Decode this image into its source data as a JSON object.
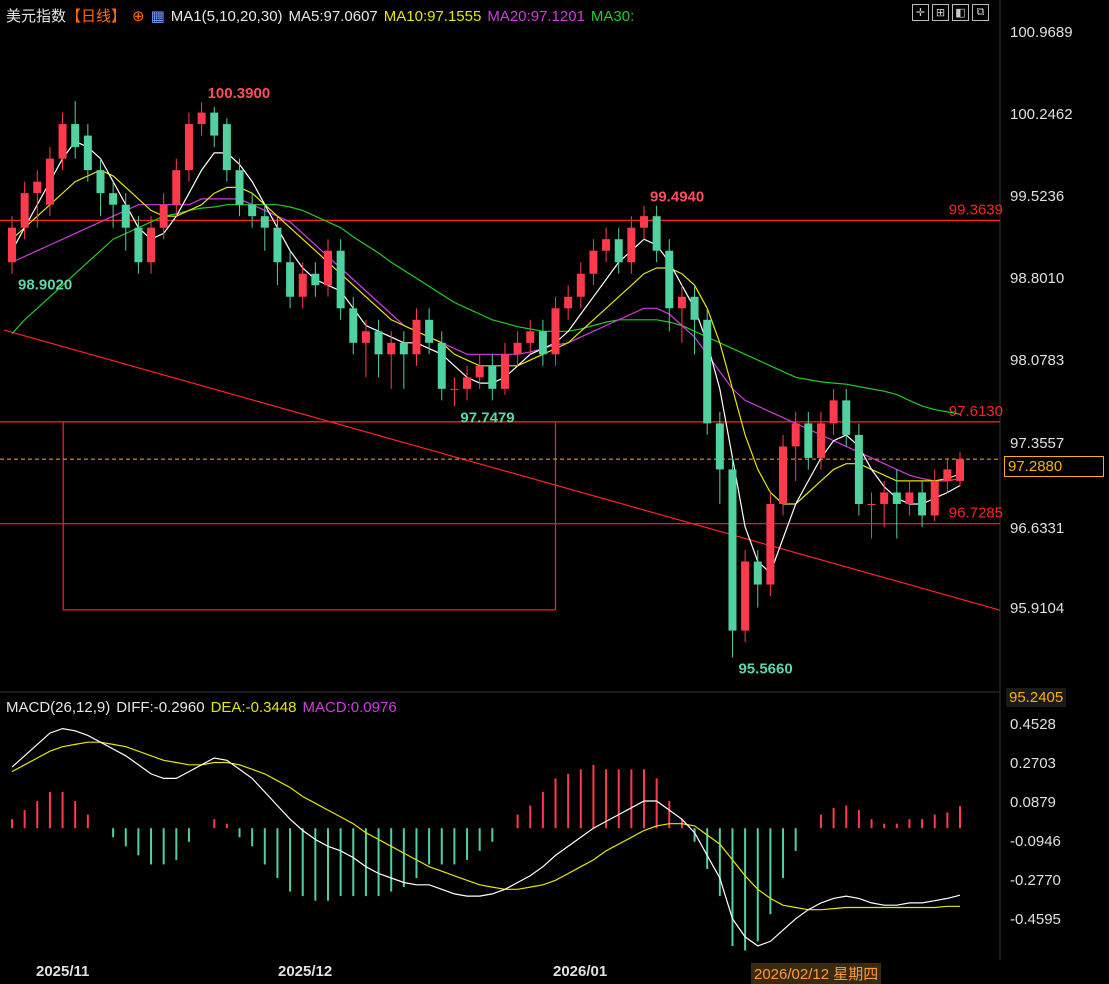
{
  "header": {
    "name": "美元指数",
    "period": "【日线】",
    "ma_label": "MA1(5,10,20,30)",
    "ma5": "MA5:97.0607",
    "ma10": "MA10:97.1555",
    "ma20": "MA20:97.1201",
    "ma30": "MA30:"
  },
  "macd_header": {
    "title": "MACD(26,12,9)",
    "diff": "DIFF:-0.2960",
    "dea": "DEA:-0.3448",
    "macd": "MACD:0.0976"
  },
  "colors": {
    "up": "#ff3a4d",
    "down": "#4fd1a0",
    "ma5": "#ffffff",
    "ma10": "#e6e600",
    "ma20": "#d23be0",
    "ma30": "#22cc22",
    "level": "#ff2222",
    "bg": "#000000"
  },
  "price_axis": [
    "100.9689",
    "100.2462",
    "99.5236",
    "98.8010",
    "98.0783",
    "97.3557",
    "96.6331",
    "95.9104",
    "95.2405"
  ],
  "macd_axis": [
    "0.4528",
    "0.2703",
    "0.0879",
    "-0.0946",
    "-0.2770",
    "-0.4595"
  ],
  "current_price": "97.2880",
  "date_labels": [
    "2025/11",
    "2025/12",
    "2026/01"
  ],
  "cursor_date": "2026/02/12 星期四",
  "chart_data": {
    "type": "candlestick",
    "ylim": [
      95.2405,
      101.0
    ],
    "candles": [
      [
        99.0,
        99.3,
        98.9,
        99.4
      ],
      [
        99.3,
        99.6,
        99.2,
        99.7
      ],
      [
        99.6,
        99.7,
        99.3,
        99.8
      ],
      [
        99.5,
        99.9,
        99.4,
        100.0
      ],
      [
        99.9,
        100.2,
        99.8,
        100.3
      ],
      [
        100.2,
        100.0,
        99.9,
        100.4
      ],
      [
        100.1,
        99.8,
        99.7,
        100.2
      ],
      [
        99.8,
        99.6,
        99.4,
        99.9
      ],
      [
        99.6,
        99.5,
        99.3,
        99.7
      ],
      [
        99.5,
        99.3,
        99.1,
        99.6
      ],
      [
        99.3,
        99.0,
        98.9,
        99.4
      ],
      [
        99.0,
        99.3,
        98.9,
        99.4
      ],
      [
        99.3,
        99.5,
        99.2,
        99.6
      ],
      [
        99.5,
        99.8,
        99.4,
        99.9
      ],
      [
        99.8,
        100.2,
        99.7,
        100.3
      ],
      [
        100.2,
        100.3,
        100.1,
        100.39
      ],
      [
        100.3,
        100.1,
        100.0,
        100.35
      ],
      [
        100.2,
        99.8,
        99.7,
        100.25
      ],
      [
        99.8,
        99.5,
        99.4,
        99.9
      ],
      [
        99.5,
        99.4,
        99.3,
        99.6
      ],
      [
        99.4,
        99.3,
        99.1,
        99.5
      ],
      [
        99.3,
        99.0,
        98.8,
        99.4
      ],
      [
        99.0,
        98.7,
        98.6,
        99.1
      ],
      [
        98.7,
        98.9,
        98.6,
        99.0
      ],
      [
        98.9,
        98.8,
        98.7,
        99.0
      ],
      [
        98.8,
        99.1,
        98.7,
        99.2
      ],
      [
        99.1,
        98.6,
        98.5,
        99.2
      ],
      [
        98.6,
        98.3,
        98.2,
        98.7
      ],
      [
        98.3,
        98.4,
        98.0,
        98.5
      ],
      [
        98.4,
        98.2,
        98.0,
        98.5
      ],
      [
        98.2,
        98.3,
        97.9,
        98.4
      ],
      [
        98.3,
        98.2,
        97.9,
        98.4
      ],
      [
        98.2,
        98.5,
        98.1,
        98.6
      ],
      [
        98.5,
        98.3,
        98.2,
        98.6
      ],
      [
        98.3,
        97.9,
        97.8,
        98.4
      ],
      [
        97.9,
        97.9,
        97.75,
        98.0
      ],
      [
        97.9,
        98.0,
        97.8,
        98.1
      ],
      [
        98.0,
        98.1,
        97.9,
        98.2
      ],
      [
        98.1,
        97.9,
        97.8,
        98.2
      ],
      [
        97.9,
        98.2,
        97.85,
        98.3
      ],
      [
        98.2,
        98.3,
        98.1,
        98.4
      ],
      [
        98.3,
        98.4,
        98.2,
        98.5
      ],
      [
        98.4,
        98.2,
        98.1,
        98.5
      ],
      [
        98.2,
        98.6,
        98.1,
        98.7
      ],
      [
        98.6,
        98.7,
        98.5,
        98.8
      ],
      [
        98.7,
        98.9,
        98.6,
        99.0
      ],
      [
        98.9,
        99.1,
        98.8,
        99.2
      ],
      [
        99.1,
        99.2,
        99.0,
        99.3
      ],
      [
        99.2,
        99.0,
        98.9,
        99.3
      ],
      [
        99.0,
        99.3,
        98.9,
        99.4
      ],
      [
        99.3,
        99.4,
        99.2,
        99.49
      ],
      [
        99.4,
        99.1,
        99.0,
        99.49
      ],
      [
        99.1,
        98.6,
        98.4,
        99.2
      ],
      [
        98.6,
        98.7,
        98.3,
        98.8
      ],
      [
        98.7,
        98.5,
        98.2,
        98.8
      ],
      [
        98.5,
        97.6,
        97.5,
        98.6
      ],
      [
        97.6,
        97.2,
        96.9,
        97.7
      ],
      [
        97.2,
        95.8,
        95.566,
        97.3
      ],
      [
        95.8,
        96.4,
        95.7,
        96.5
      ],
      [
        96.4,
        96.2,
        96.0,
        96.5
      ],
      [
        96.2,
        96.9,
        96.1,
        97.0
      ],
      [
        96.9,
        97.4,
        96.8,
        97.5
      ],
      [
        97.4,
        97.6,
        97.1,
        97.7
      ],
      [
        97.6,
        97.3,
        97.2,
        97.7
      ],
      [
        97.3,
        97.6,
        97.2,
        97.7
      ],
      [
        97.6,
        97.8,
        97.5,
        97.9
      ],
      [
        97.8,
        97.5,
        97.4,
        97.9
      ],
      [
        97.5,
        96.9,
        96.8,
        97.6
      ],
      [
        96.9,
        96.9,
        96.6,
        97.0
      ],
      [
        96.9,
        97.0,
        96.7,
        97.1
      ],
      [
        97.0,
        96.9,
        96.6,
        97.2
      ],
      [
        96.9,
        97.0,
        96.8,
        97.1
      ],
      [
        97.0,
        96.8,
        96.7,
        97.1
      ],
      [
        96.8,
        97.1,
        96.75,
        97.2
      ],
      [
        97.1,
        97.2,
        97.0,
        97.3
      ],
      [
        97.1,
        97.29,
        97.05,
        97.35
      ]
    ],
    "levels": [
      {
        "value": 99.3639,
        "label": "99.3639"
      },
      {
        "value": 97.613,
        "label": "97.6130"
      },
      {
        "value": 96.7285,
        "label": "96.7285"
      }
    ],
    "annotations": [
      {
        "label": "100.3900",
        "value": 100.39,
        "index": 15
      },
      {
        "label": "98.9020",
        "value": 98.902,
        "index": 0
      },
      {
        "label": "97.7479",
        "value": 97.7479,
        "index": 35
      },
      {
        "label": "99.4940",
        "value": 99.494,
        "index": 50
      },
      {
        "label": "95.5660",
        "value": 95.566,
        "index": 57
      }
    ],
    "trendline": {
      "from": [
        0,
        98.38
      ],
      "to": [
        75,
        96.07
      ]
    },
    "rectangle": {
      "from_index": 5,
      "to_index": 43,
      "top": 97.613,
      "bottom": 95.98
    },
    "ma5": [
      99.1,
      99.3,
      99.5,
      99.7,
      99.9,
      100.05,
      100.0,
      99.9,
      99.7,
      99.5,
      99.3,
      99.2,
      99.25,
      99.4,
      99.6,
      99.8,
      99.95,
      99.95,
      99.85,
      99.7,
      99.5,
      99.3,
      99.1,
      98.95,
      98.85,
      98.8,
      98.75,
      98.6,
      98.45,
      98.4,
      98.35,
      98.3,
      98.3,
      98.25,
      98.2,
      98.1,
      98.0,
      97.95,
      97.95,
      98.0,
      98.1,
      98.2,
      98.25,
      98.3,
      98.4,
      98.55,
      98.7,
      98.85,
      99.0,
      99.1,
      99.2,
      99.15,
      99.0,
      98.8,
      98.6,
      98.3,
      97.9,
      97.3,
      96.7,
      96.4,
      96.3,
      96.6,
      96.9,
      97.1,
      97.3,
      97.45,
      97.5,
      97.4,
      97.2,
      97.05,
      96.95,
      96.9,
      96.9,
      96.95,
      97.0,
      97.06
    ],
    "ma10": [
      99.2,
      99.3,
      99.4,
      99.5,
      99.6,
      99.7,
      99.75,
      99.8,
      99.75,
      99.65,
      99.55,
      99.45,
      99.4,
      99.4,
      99.45,
      99.5,
      99.6,
      99.65,
      99.65,
      99.6,
      99.5,
      99.4,
      99.3,
      99.2,
      99.1,
      99.0,
      98.9,
      98.8,
      98.7,
      98.6,
      98.5,
      98.45,
      98.4,
      98.35,
      98.3,
      98.2,
      98.15,
      98.1,
      98.1,
      98.1,
      98.1,
      98.15,
      98.2,
      98.25,
      98.3,
      98.4,
      98.5,
      98.6,
      98.7,
      98.8,
      98.9,
      98.95,
      98.95,
      98.9,
      98.8,
      98.6,
      98.3,
      97.9,
      97.5,
      97.2,
      97.0,
      96.9,
      96.9,
      97.0,
      97.1,
      97.2,
      97.25,
      97.25,
      97.2,
      97.15,
      97.1,
      97.1,
      97.1,
      97.1,
      97.12,
      97.16
    ],
    "ma20": [
      99.0,
      99.05,
      99.1,
      99.15,
      99.2,
      99.25,
      99.3,
      99.35,
      99.4,
      99.45,
      99.5,
      99.5,
      99.5,
      99.5,
      99.5,
      99.55,
      99.55,
      99.55,
      99.55,
      99.5,
      99.45,
      99.4,
      99.35,
      99.25,
      99.15,
      99.05,
      98.95,
      98.85,
      98.75,
      98.65,
      98.55,
      98.45,
      98.4,
      98.35,
      98.3,
      98.25,
      98.2,
      98.2,
      98.2,
      98.2,
      98.2,
      98.22,
      98.25,
      98.28,
      98.3,
      98.35,
      98.4,
      98.45,
      98.5,
      98.55,
      98.6,
      98.6,
      98.55,
      98.45,
      98.35,
      98.2,
      98.05,
      97.9,
      97.8,
      97.75,
      97.7,
      97.65,
      97.6,
      97.55,
      97.5,
      97.45,
      97.4,
      97.35,
      97.3,
      97.25,
      97.2,
      97.15,
      97.12,
      97.1,
      97.1,
      97.12
    ],
    "ma30": [
      98.38,
      98.5,
      98.6,
      98.7,
      98.8,
      98.9,
      99.0,
      99.1,
      99.2,
      99.25,
      99.3,
      99.35,
      99.4,
      99.42,
      99.45,
      99.47,
      99.48,
      99.5,
      99.5,
      99.5,
      99.5,
      99.5,
      99.48,
      99.45,
      99.4,
      99.35,
      99.3,
      99.22,
      99.15,
      99.08,
      99.0,
      98.93,
      98.86,
      98.79,
      98.72,
      98.65,
      98.6,
      98.55,
      98.5,
      98.47,
      98.44,
      98.42,
      98.4,
      98.4,
      98.4,
      98.42,
      98.45,
      98.48,
      98.5,
      98.5,
      98.5,
      98.5,
      98.48,
      98.45,
      98.4,
      98.35,
      98.3,
      98.25,
      98.2,
      98.15,
      98.1,
      98.05,
      98.0,
      97.98,
      97.96,
      97.95,
      97.94,
      97.92,
      97.9,
      97.88,
      97.85,
      97.8,
      97.75,
      97.72,
      97.7,
      97.68
    ],
    "macd": {
      "ylim": [
        -0.56,
        0.5
      ],
      "diff": [
        0.27,
        0.32,
        0.37,
        0.42,
        0.44,
        0.43,
        0.41,
        0.38,
        0.35,
        0.32,
        0.28,
        0.24,
        0.22,
        0.22,
        0.25,
        0.28,
        0.31,
        0.3,
        0.26,
        0.22,
        0.16,
        0.1,
        0.04,
        -0.01,
        -0.05,
        -0.08,
        -0.1,
        -0.13,
        -0.17,
        -0.2,
        -0.22,
        -0.24,
        -0.25,
        -0.25,
        -0.27,
        -0.29,
        -0.3,
        -0.3,
        -0.29,
        -0.27,
        -0.24,
        -0.21,
        -0.17,
        -0.12,
        -0.08,
        -0.04,
        0.0,
        0.03,
        0.06,
        0.09,
        0.12,
        0.12,
        0.08,
        0.04,
        -0.02,
        -0.12,
        -0.22,
        -0.4,
        -0.48,
        -0.52,
        -0.5,
        -0.45,
        -0.4,
        -0.36,
        -0.33,
        -0.31,
        -0.3,
        -0.31,
        -0.33,
        -0.34,
        -0.34,
        -0.33,
        -0.33,
        -0.32,
        -0.31,
        -0.296
      ],
      "dea": [
        0.25,
        0.28,
        0.31,
        0.34,
        0.36,
        0.37,
        0.38,
        0.38,
        0.37,
        0.36,
        0.34,
        0.32,
        0.3,
        0.29,
        0.28,
        0.28,
        0.29,
        0.29,
        0.28,
        0.26,
        0.24,
        0.21,
        0.18,
        0.14,
        0.11,
        0.08,
        0.05,
        0.02,
        -0.02,
        -0.05,
        -0.08,
        -0.11,
        -0.14,
        -0.17,
        -0.19,
        -0.21,
        -0.23,
        -0.25,
        -0.26,
        -0.27,
        -0.27,
        -0.26,
        -0.25,
        -0.23,
        -0.2,
        -0.17,
        -0.14,
        -0.1,
        -0.07,
        -0.04,
        -0.01,
        0.01,
        0.02,
        0.02,
        0.01,
        -0.03,
        -0.07,
        -0.14,
        -0.21,
        -0.27,
        -0.31,
        -0.34,
        -0.35,
        -0.36,
        -0.36,
        -0.355,
        -0.35,
        -0.35,
        -0.35,
        -0.35,
        -0.35,
        -0.35,
        -0.35,
        -0.35,
        -0.345,
        -0.3448
      ]
    }
  }
}
